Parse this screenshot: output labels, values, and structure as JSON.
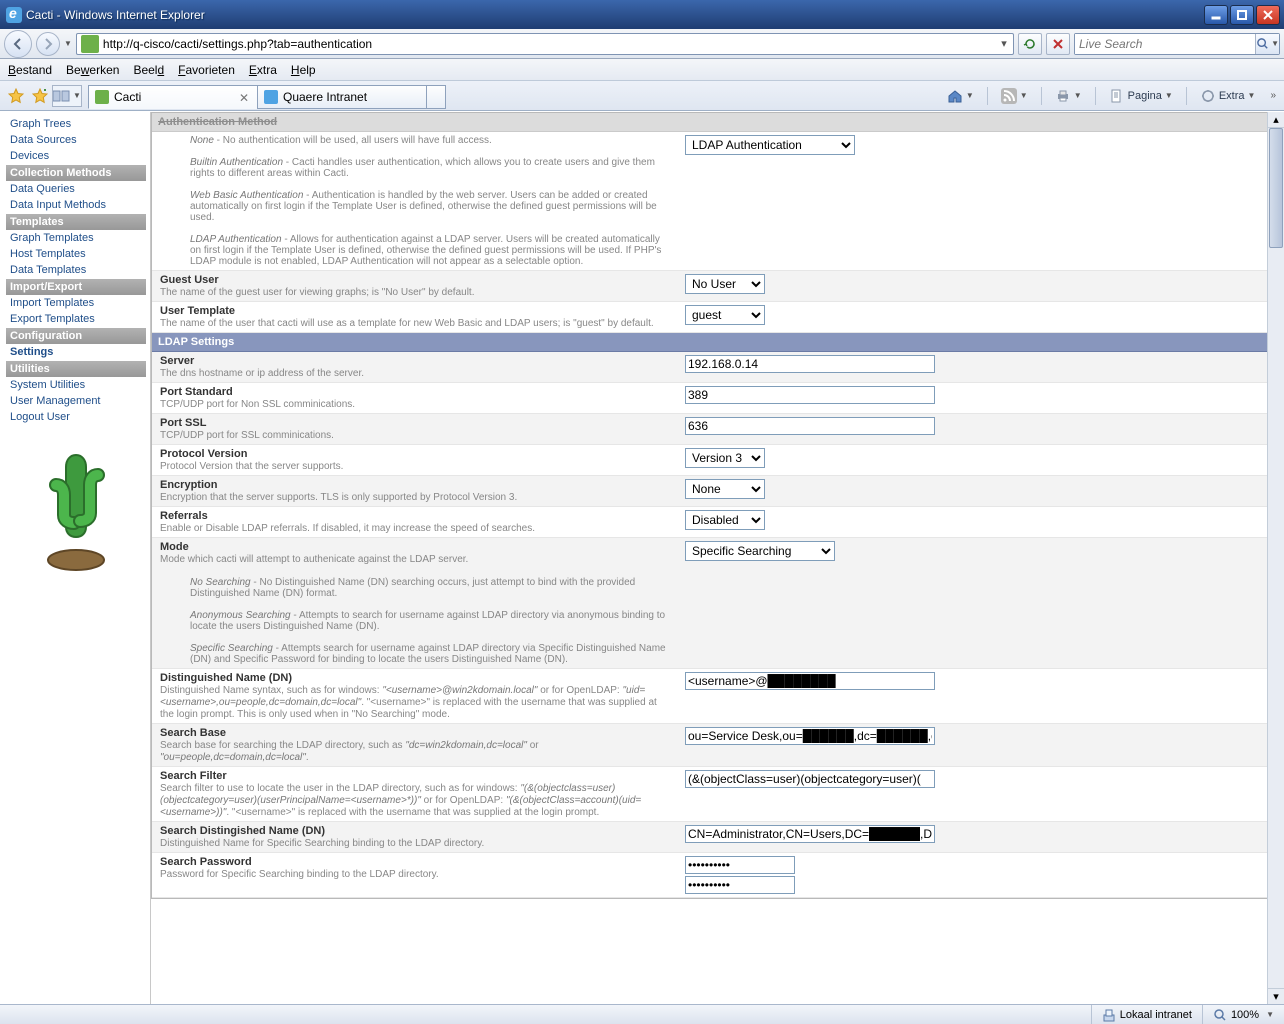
{
  "window": {
    "title": "Cacti - Windows Internet Explorer"
  },
  "address": {
    "url": "http://q-cisco/cacti/settings.php?tab=authentication"
  },
  "search": {
    "placeholder": "Live Search"
  },
  "menu": {
    "items": [
      "Bestand",
      "Bewerken",
      "Beeld",
      "Favorieten",
      "Extra",
      "Help"
    ]
  },
  "tabs": [
    {
      "label": "Cacti",
      "active": true,
      "icon": "cacti"
    },
    {
      "label": "Quaere Intranet",
      "active": false,
      "icon": "ie"
    }
  ],
  "toolbar": {
    "pagina": "Pagina",
    "extra": "Extra"
  },
  "sidebar": {
    "sections": [
      {
        "header": null,
        "items": [
          "Graph Trees",
          "Data Sources",
          "Devices"
        ]
      },
      {
        "header": "Collection Methods",
        "items": [
          "Data Queries",
          "Data Input Methods"
        ]
      },
      {
        "header": "Templates",
        "items": [
          "Graph Templates",
          "Host Templates",
          "Data Templates"
        ]
      },
      {
        "header": "Import/Export",
        "items": [
          "Import Templates",
          "Export Templates"
        ]
      },
      {
        "header": "Configuration",
        "items": [
          "Settings"
        ]
      },
      {
        "header": "Utilities",
        "items": [
          "System Utilities",
          "User Management",
          "Logout User"
        ]
      }
    ],
    "active": "Settings"
  },
  "settings": {
    "auth_section_title": "Authentication Method",
    "auth_help": {
      "none_label": "None",
      "none_text": " - No authentication will be used, all users will have full access.",
      "builtin_label": "Builtin Authentication",
      "builtin_text": " - Cacti handles user authentication, which allows you to create users and give them rights to different areas within Cacti.",
      "web_label": "Web Basic Authentication",
      "web_text": " - Authentication is handled by the web server. Users can be added or created automatically on first login if the Template User is defined, otherwise the defined guest permissions will be used.",
      "ldap_label": "LDAP Authentication",
      "ldap_text": " - Allows for authentication against a LDAP server. Users will be created automatically on first login if the Template User is defined, otherwise the defined guest permissions will be used. If PHP's LDAP module is not enabled, LDAP Authentication will not appear as a selectable option."
    },
    "auth_method_value": "LDAP Authentication",
    "guest": {
      "label": "Guest User",
      "help": "The name of the guest user for viewing graphs; is \"No User\" by default.",
      "value": "No User"
    },
    "template_user": {
      "label": "User Template",
      "help": "The name of the user that cacti will use as a template for new Web Basic and LDAP users; is \"guest\" by default.",
      "value": "guest"
    },
    "ldap_section_title": "LDAP Settings",
    "ldap": {
      "server": {
        "label": "Server",
        "help": "The dns hostname or ip address of the server.",
        "value": "192.168.0.14"
      },
      "port": {
        "label": "Port Standard",
        "help": "TCP/UDP port for Non SSL comminications.",
        "value": "389"
      },
      "port_ssl": {
        "label": "Port SSL",
        "help": "TCP/UDP port for SSL comminications.",
        "value": "636"
      },
      "version": {
        "label": "Protocol Version",
        "help": "Protocol Version that the server supports.",
        "value": "Version 3"
      },
      "encryption": {
        "label": "Encryption",
        "help": "Encryption that the server supports. TLS is only supported by Protocol Version 3.",
        "value": "None"
      },
      "referrals": {
        "label": "Referrals",
        "help": "Enable or Disable LDAP referrals. If disabled, it may increase the speed of searches.",
        "value": "Disabled"
      },
      "mode": {
        "label": "Mode",
        "help": "Mode which cacti will attempt to authenicate against the LDAP server.",
        "no_label": "No Searching",
        "no_text": " - No Distinguished Name (DN) searching occurs, just attempt to bind with the provided Distinguished Name (DN) format.",
        "anon_label": "Anonymous Searching",
        "anon_text": " - Attempts to search for username against LDAP directory via anonymous binding to locate the users Distinguished Name (DN).",
        "spec_label": "Specific Searching",
        "spec_text": " - Attempts search for username against LDAP directory via Specific Distinguished Name (DN) and Specific Password for binding to locate the users Distinguished Name (DN).",
        "value": "Specific Searching"
      },
      "dn": {
        "label": "Distinguished Name (DN)",
        "help_a": "Distinguished Name syntax, such as for windows: ",
        "help_b": "\"<username>@win2kdomain.local\"",
        "help_c": " or for OpenLDAP: ",
        "help_d": "\"uid=<username>,ou=people,dc=domain,dc=local\"",
        "help_e": ". \"<username>\" is replaced with the username that was supplied at the login prompt. This is only used when in \"No Searching\" mode.",
        "value": "<username>@████████"
      },
      "search_base": {
        "label": "Search Base",
        "help_a": "Search base for searching the LDAP directory, such as ",
        "help_b": "\"dc=win2kdomain,dc=local\"",
        "help_c": " or ",
        "help_d": "\"ou=people,dc=domain,dc=local\"",
        "help_e": ".",
        "value": "ou=Service Desk,ou=██████,dc=██████,dc"
      },
      "search_filter": {
        "label": "Search Filter",
        "help_a": "Search filter to use to locate the user in the LDAP directory, such as for windows: ",
        "help_b": "\"(&(objectclass=user)(objectcategory=user)(userPrincipalName=<username>*))\"",
        "help_c": " or for OpenLDAP: ",
        "help_d": "\"(&(objectClass=account)(uid=<username>))\"",
        "help_e": ". \"<username>\" is replaced with the username that was supplied at the login prompt.",
        "value": "(&(objectClass=user)(objectcategory=user)("
      },
      "search_dn": {
        "label": "Search Distingished Name (DN)",
        "help": "Distinguished Name for Specific Searching binding to the LDAP directory.",
        "value": "CN=Administrator,CN=Users,DC=██████,DC"
      },
      "search_pw": {
        "label": "Search Password",
        "help": "Password for Specific Searching binding to the LDAP directory.",
        "value": "••••••••••"
      }
    }
  },
  "status": {
    "zone": "Lokaal intranet",
    "zoom": "100%"
  }
}
